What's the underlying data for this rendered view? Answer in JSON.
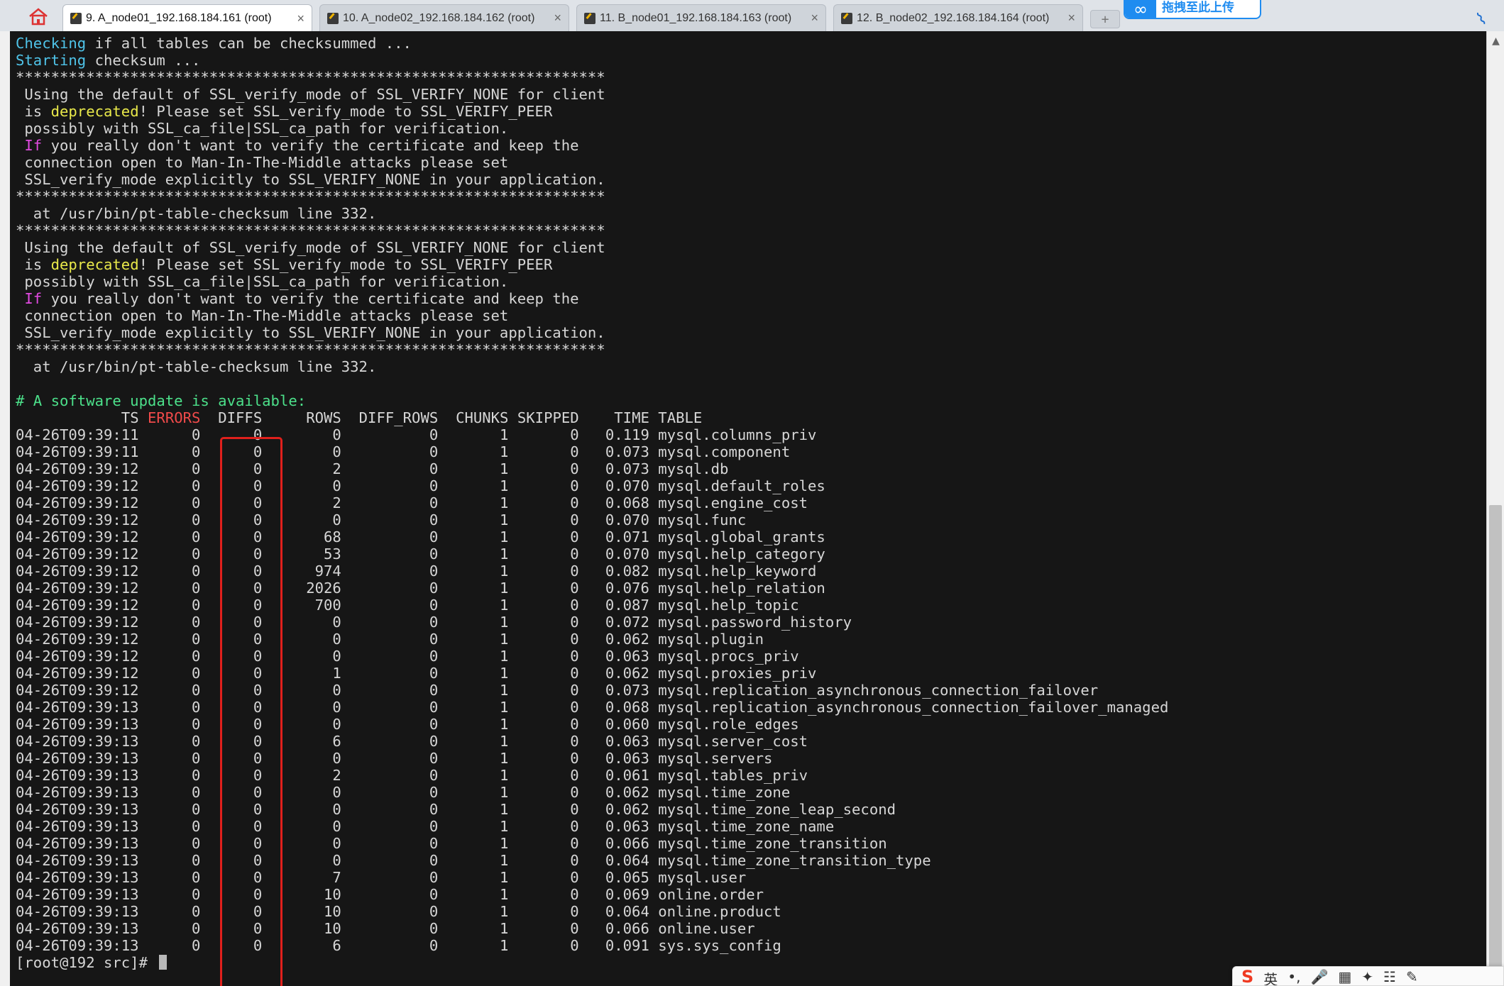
{
  "tabs": [
    {
      "label": "9. A_node01_192.168.184.161 (root)",
      "close": "×",
      "active": true
    },
    {
      "label": "10. A_node02_192.168.184.162 (root)",
      "close": "×",
      "active": false
    },
    {
      "label": "11. B_node01_192.168.184.163 (root)",
      "close": "×",
      "active": false
    },
    {
      "label": "12. B_node02_192.168.184.164 (root)",
      "close": "×",
      "active": false
    }
  ],
  "upload_widget": {
    "text": "拖拽至此上传"
  },
  "terminal": {
    "pre_lines": [
      [
        {
          "t": "Checking",
          "c": "c-cyan"
        },
        {
          "t": " if all tables can be checksummed ..."
        }
      ],
      [
        {
          "t": "Starting",
          "c": "c-cyan"
        },
        {
          "t": " checksum ..."
        }
      ],
      [
        {
          "t": "*******************************************************************"
        }
      ],
      [
        {
          "t": " Using the default of SSL_verify_mode of SSL_VERIFY_NONE for client"
        }
      ],
      [
        {
          "t": " is "
        },
        {
          "t": "deprecated",
          "c": "c-yellow"
        },
        {
          "t": "! Please set SSL_verify_mode to SSL_VERIFY_PEER"
        }
      ],
      [
        {
          "t": " possibly with SSL_ca_file|SSL_ca_path for verification."
        }
      ],
      [
        {
          "t": " "
        },
        {
          "t": "If",
          "c": "c-magenta"
        },
        {
          "t": " you really don't want to verify the certificate and keep the"
        }
      ],
      [
        {
          "t": " connection open to Man-In-The-Middle attacks please set"
        }
      ],
      [
        {
          "t": " SSL_verify_mode explicitly to SSL_VERIFY_NONE in your application."
        }
      ],
      [
        {
          "t": "*******************************************************************"
        }
      ],
      [
        {
          "t": "  at /usr/bin/pt-table-checksum line 332."
        }
      ],
      [
        {
          "t": "*******************************************************************"
        }
      ],
      [
        {
          "t": " Using the default of SSL_verify_mode of SSL_VERIFY_NONE for client"
        }
      ],
      [
        {
          "t": " is "
        },
        {
          "t": "deprecated",
          "c": "c-yellow"
        },
        {
          "t": "! Please set SSL_verify_mode to SSL_VERIFY_PEER"
        }
      ],
      [
        {
          "t": " possibly with SSL_ca_file|SSL_ca_path for verification."
        }
      ],
      [
        {
          "t": " "
        },
        {
          "t": "If",
          "c": "c-magenta"
        },
        {
          "t": " you really don't want to verify the certificate and keep the"
        }
      ],
      [
        {
          "t": " connection open to Man-In-The-Middle attacks please set"
        }
      ],
      [
        {
          "t": " SSL_verify_mode explicitly to SSL_VERIFY_NONE in your application."
        }
      ],
      [
        {
          "t": "*******************************************************************"
        }
      ],
      [
        {
          "t": "  at /usr/bin/pt-table-checksum line 332."
        }
      ],
      [
        {
          "t": ""
        }
      ],
      [
        {
          "t": "# A software update is available:",
          "c": "c-green"
        }
      ]
    ],
    "columns": [
      "TS",
      "ERRORS",
      "DIFFS",
      "ROWS",
      "DIFF_ROWS",
      "CHUNKS",
      "SKIPPED",
      "TIME",
      "TABLE"
    ],
    "rows": [
      [
        "04-26T09:39:11",
        "0",
        "0",
        "0",
        "0",
        "1",
        "0",
        "0.119",
        "mysql.columns_priv"
      ],
      [
        "04-26T09:39:11",
        "0",
        "0",
        "0",
        "0",
        "1",
        "0",
        "0.073",
        "mysql.component"
      ],
      [
        "04-26T09:39:12",
        "0",
        "0",
        "2",
        "0",
        "1",
        "0",
        "0.073",
        "mysql.db"
      ],
      [
        "04-26T09:39:12",
        "0",
        "0",
        "0",
        "0",
        "1",
        "0",
        "0.070",
        "mysql.default_roles"
      ],
      [
        "04-26T09:39:12",
        "0",
        "0",
        "2",
        "0",
        "1",
        "0",
        "0.068",
        "mysql.engine_cost"
      ],
      [
        "04-26T09:39:12",
        "0",
        "0",
        "0",
        "0",
        "1",
        "0",
        "0.070",
        "mysql.func"
      ],
      [
        "04-26T09:39:12",
        "0",
        "0",
        "68",
        "0",
        "1",
        "0",
        "0.071",
        "mysql.global_grants"
      ],
      [
        "04-26T09:39:12",
        "0",
        "0",
        "53",
        "0",
        "1",
        "0",
        "0.070",
        "mysql.help_category"
      ],
      [
        "04-26T09:39:12",
        "0",
        "0",
        "974",
        "0",
        "1",
        "0",
        "0.082",
        "mysql.help_keyword"
      ],
      [
        "04-26T09:39:12",
        "0",
        "0",
        "2026",
        "0",
        "1",
        "0",
        "0.076",
        "mysql.help_relation"
      ],
      [
        "04-26T09:39:12",
        "0",
        "0",
        "700",
        "0",
        "1",
        "0",
        "0.087",
        "mysql.help_topic"
      ],
      [
        "04-26T09:39:12",
        "0",
        "0",
        "0",
        "0",
        "1",
        "0",
        "0.072",
        "mysql.password_history"
      ],
      [
        "04-26T09:39:12",
        "0",
        "0",
        "0",
        "0",
        "1",
        "0",
        "0.062",
        "mysql.plugin"
      ],
      [
        "04-26T09:39:12",
        "0",
        "0",
        "0",
        "0",
        "1",
        "0",
        "0.063",
        "mysql.procs_priv"
      ],
      [
        "04-26T09:39:12",
        "0",
        "0",
        "1",
        "0",
        "1",
        "0",
        "0.062",
        "mysql.proxies_priv"
      ],
      [
        "04-26T09:39:12",
        "0",
        "0",
        "0",
        "0",
        "1",
        "0",
        "0.073",
        "mysql.replication_asynchronous_connection_failover"
      ],
      [
        "04-26T09:39:13",
        "0",
        "0",
        "0",
        "0",
        "1",
        "0",
        "0.068",
        "mysql.replication_asynchronous_connection_failover_managed"
      ],
      [
        "04-26T09:39:13",
        "0",
        "0",
        "0",
        "0",
        "1",
        "0",
        "0.060",
        "mysql.role_edges"
      ],
      [
        "04-26T09:39:13",
        "0",
        "0",
        "6",
        "0",
        "1",
        "0",
        "0.063",
        "mysql.server_cost"
      ],
      [
        "04-26T09:39:13",
        "0",
        "0",
        "0",
        "0",
        "1",
        "0",
        "0.063",
        "mysql.servers"
      ],
      [
        "04-26T09:39:13",
        "0",
        "0",
        "2",
        "0",
        "1",
        "0",
        "0.061",
        "mysql.tables_priv"
      ],
      [
        "04-26T09:39:13",
        "0",
        "0",
        "0",
        "0",
        "1",
        "0",
        "0.062",
        "mysql.time_zone"
      ],
      [
        "04-26T09:39:13",
        "0",
        "0",
        "0",
        "0",
        "1",
        "0",
        "0.062",
        "mysql.time_zone_leap_second"
      ],
      [
        "04-26T09:39:13",
        "0",
        "0",
        "0",
        "0",
        "1",
        "0",
        "0.063",
        "mysql.time_zone_name"
      ],
      [
        "04-26T09:39:13",
        "0",
        "0",
        "0",
        "0",
        "1",
        "0",
        "0.066",
        "mysql.time_zone_transition"
      ],
      [
        "04-26T09:39:13",
        "0",
        "0",
        "0",
        "0",
        "1",
        "0",
        "0.064",
        "mysql.time_zone_transition_type"
      ],
      [
        "04-26T09:39:13",
        "0",
        "0",
        "7",
        "0",
        "1",
        "0",
        "0.065",
        "mysql.user"
      ],
      [
        "04-26T09:39:13",
        "0",
        "0",
        "10",
        "0",
        "1",
        "0",
        "0.069",
        "online.order"
      ],
      [
        "04-26T09:39:13",
        "0",
        "0",
        "10",
        "0",
        "1",
        "0",
        "0.064",
        "online.product"
      ],
      [
        "04-26T09:39:13",
        "0",
        "0",
        "10",
        "0",
        "1",
        "0",
        "0.066",
        "online.user"
      ],
      [
        "04-26T09:39:13",
        "0",
        "0",
        "6",
        "0",
        "1",
        "0",
        "0.091",
        "sys.sys_config"
      ]
    ],
    "prompt": "[root@192 src]# "
  },
  "ime_toolbar": {
    "items": [
      "S",
      "英",
      "•,",
      "🎤",
      "▦",
      "✦",
      "☷",
      "✎"
    ]
  },
  "colors": {
    "highlight_box": "#e0201c",
    "cyan": "#4fc3e8",
    "yellow": "#e8e84a",
    "magenta": "#e04ae0",
    "green": "#4ce08a",
    "red": "#f04a4a"
  }
}
